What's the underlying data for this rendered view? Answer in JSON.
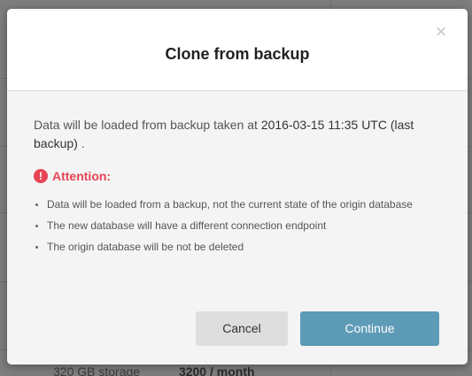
{
  "dialog": {
    "title": "Clone from backup",
    "close_glyph": "×",
    "info_prefix": "Data will be loaded from backup taken at ",
    "backup_timestamp": "2016-03-15 11:35 UTC (last backup)",
    "info_suffix": " .",
    "attention_label": "Attention:",
    "attention_icon": "!",
    "bullets": [
      "Data will be loaded from a backup, not the current state of the origin database",
      "The new database will have a different connection endpoint",
      "The origin database will be not be deleted"
    ],
    "cancel_label": "Cancel",
    "continue_label": "Continue"
  },
  "background": {
    "footer_storage": "320 GB storage",
    "footer_price": "3200 / month"
  },
  "colors": {
    "primary_button": "#5e9bb6",
    "attention": "#e64555",
    "overlay": "#7d7d7d"
  },
  "icons": {
    "close": "close-icon",
    "attention": "exclamation-circle-icon"
  }
}
